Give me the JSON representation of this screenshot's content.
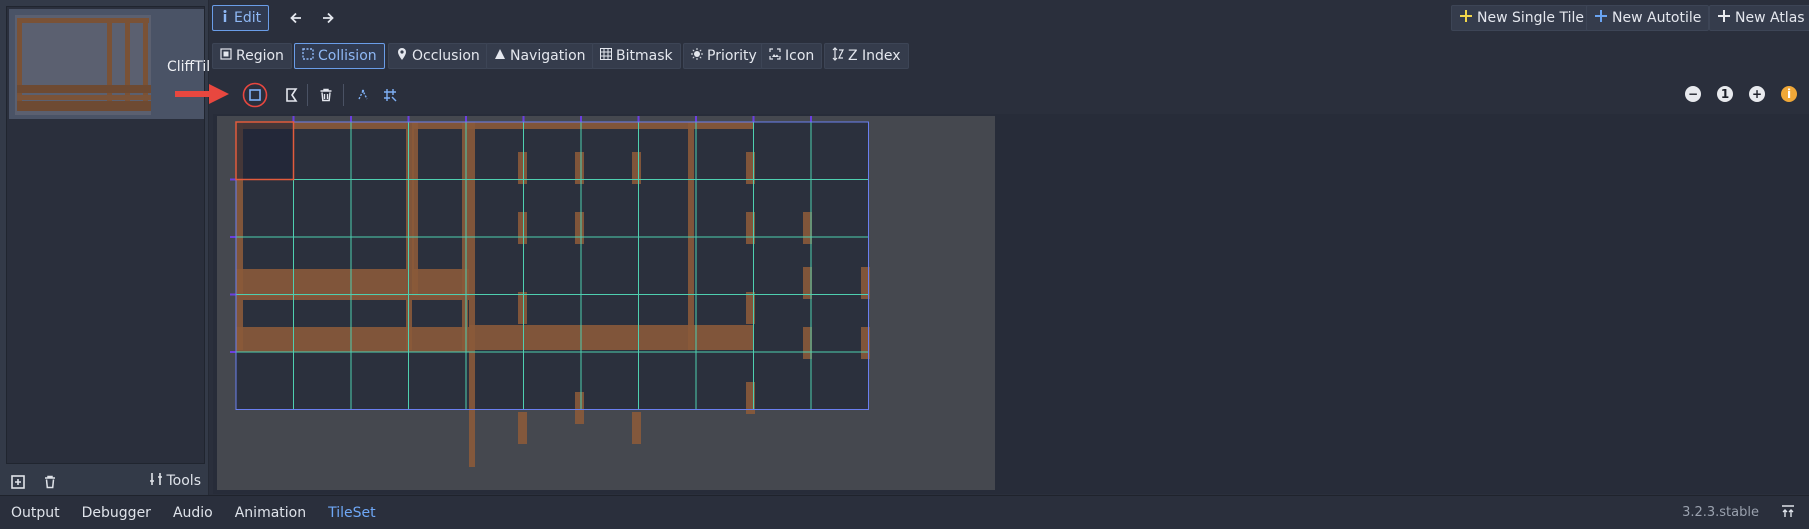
{
  "texture_panel": {
    "texture_name": "CliffTil",
    "tools_label": "Tools"
  },
  "top_toolbar": {
    "edit_label": "Edit",
    "new_single_tile": "New Single Tile",
    "new_autotile": "New Autotile",
    "new_atlas": "New Atlas"
  },
  "mode_tabs": [
    {
      "label": "Region",
      "icon": "region-icon"
    },
    {
      "label": "Collision",
      "icon": "collision-icon",
      "active": true
    },
    {
      "label": "Occlusion",
      "icon": "occlusion-icon"
    },
    {
      "label": "Navigation",
      "icon": "navigation-icon"
    },
    {
      "label": "Bitmask",
      "icon": "bitmask-icon"
    },
    {
      "label": "Priority",
      "icon": "priority-icon"
    },
    {
      "label": "Icon",
      "icon": "icon-icon"
    },
    {
      "label": "Z Index",
      "icon": "zindex-icon"
    }
  ],
  "atlas_grid": {
    "columns": 11,
    "rows": 5,
    "selected_cell": [
      0,
      0
    ]
  },
  "bottom_tabs": [
    {
      "label": "Output"
    },
    {
      "label": "Debugger"
    },
    {
      "label": "Audio"
    },
    {
      "label": "Animation"
    },
    {
      "label": "TileSet",
      "active": true
    }
  ],
  "version": "3.2.3.stable",
  "colors": {
    "accent": "#6fa8f7",
    "grid_line": "#4ecfb0",
    "grid_border": "#6a7ff0",
    "selection": "#e25b3c",
    "arrow": "#e8473f",
    "dirt": "#8a5a3a"
  }
}
